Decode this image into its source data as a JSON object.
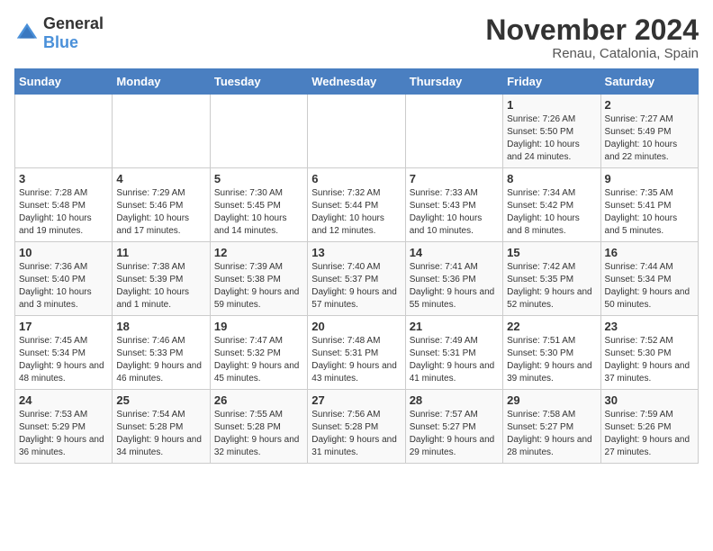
{
  "header": {
    "logo_general": "General",
    "logo_blue": "Blue",
    "month_title": "November 2024",
    "location": "Renau, Catalonia, Spain"
  },
  "days_of_week": [
    "Sunday",
    "Monday",
    "Tuesday",
    "Wednesday",
    "Thursday",
    "Friday",
    "Saturday"
  ],
  "weeks": [
    {
      "days": [
        {
          "num": "",
          "info": ""
        },
        {
          "num": "",
          "info": ""
        },
        {
          "num": "",
          "info": ""
        },
        {
          "num": "",
          "info": ""
        },
        {
          "num": "",
          "info": ""
        },
        {
          "num": "1",
          "info": "Sunrise: 7:26 AM\nSunset: 5:50 PM\nDaylight: 10 hours and 24 minutes."
        },
        {
          "num": "2",
          "info": "Sunrise: 7:27 AM\nSunset: 5:49 PM\nDaylight: 10 hours and 22 minutes."
        }
      ]
    },
    {
      "days": [
        {
          "num": "3",
          "info": "Sunrise: 7:28 AM\nSunset: 5:48 PM\nDaylight: 10 hours and 19 minutes."
        },
        {
          "num": "4",
          "info": "Sunrise: 7:29 AM\nSunset: 5:46 PM\nDaylight: 10 hours and 17 minutes."
        },
        {
          "num": "5",
          "info": "Sunrise: 7:30 AM\nSunset: 5:45 PM\nDaylight: 10 hours and 14 minutes."
        },
        {
          "num": "6",
          "info": "Sunrise: 7:32 AM\nSunset: 5:44 PM\nDaylight: 10 hours and 12 minutes."
        },
        {
          "num": "7",
          "info": "Sunrise: 7:33 AM\nSunset: 5:43 PM\nDaylight: 10 hours and 10 minutes."
        },
        {
          "num": "8",
          "info": "Sunrise: 7:34 AM\nSunset: 5:42 PM\nDaylight: 10 hours and 8 minutes."
        },
        {
          "num": "9",
          "info": "Sunrise: 7:35 AM\nSunset: 5:41 PM\nDaylight: 10 hours and 5 minutes."
        }
      ]
    },
    {
      "days": [
        {
          "num": "10",
          "info": "Sunrise: 7:36 AM\nSunset: 5:40 PM\nDaylight: 10 hours and 3 minutes."
        },
        {
          "num": "11",
          "info": "Sunrise: 7:38 AM\nSunset: 5:39 PM\nDaylight: 10 hours and 1 minute."
        },
        {
          "num": "12",
          "info": "Sunrise: 7:39 AM\nSunset: 5:38 PM\nDaylight: 9 hours and 59 minutes."
        },
        {
          "num": "13",
          "info": "Sunrise: 7:40 AM\nSunset: 5:37 PM\nDaylight: 9 hours and 57 minutes."
        },
        {
          "num": "14",
          "info": "Sunrise: 7:41 AM\nSunset: 5:36 PM\nDaylight: 9 hours and 55 minutes."
        },
        {
          "num": "15",
          "info": "Sunrise: 7:42 AM\nSunset: 5:35 PM\nDaylight: 9 hours and 52 minutes."
        },
        {
          "num": "16",
          "info": "Sunrise: 7:44 AM\nSunset: 5:34 PM\nDaylight: 9 hours and 50 minutes."
        }
      ]
    },
    {
      "days": [
        {
          "num": "17",
          "info": "Sunrise: 7:45 AM\nSunset: 5:34 PM\nDaylight: 9 hours and 48 minutes."
        },
        {
          "num": "18",
          "info": "Sunrise: 7:46 AM\nSunset: 5:33 PM\nDaylight: 9 hours and 46 minutes."
        },
        {
          "num": "19",
          "info": "Sunrise: 7:47 AM\nSunset: 5:32 PM\nDaylight: 9 hours and 45 minutes."
        },
        {
          "num": "20",
          "info": "Sunrise: 7:48 AM\nSunset: 5:31 PM\nDaylight: 9 hours and 43 minutes."
        },
        {
          "num": "21",
          "info": "Sunrise: 7:49 AM\nSunset: 5:31 PM\nDaylight: 9 hours and 41 minutes."
        },
        {
          "num": "22",
          "info": "Sunrise: 7:51 AM\nSunset: 5:30 PM\nDaylight: 9 hours and 39 minutes."
        },
        {
          "num": "23",
          "info": "Sunrise: 7:52 AM\nSunset: 5:30 PM\nDaylight: 9 hours and 37 minutes."
        }
      ]
    },
    {
      "days": [
        {
          "num": "24",
          "info": "Sunrise: 7:53 AM\nSunset: 5:29 PM\nDaylight: 9 hours and 36 minutes."
        },
        {
          "num": "25",
          "info": "Sunrise: 7:54 AM\nSunset: 5:28 PM\nDaylight: 9 hours and 34 minutes."
        },
        {
          "num": "26",
          "info": "Sunrise: 7:55 AM\nSunset: 5:28 PM\nDaylight: 9 hours and 32 minutes."
        },
        {
          "num": "27",
          "info": "Sunrise: 7:56 AM\nSunset: 5:28 PM\nDaylight: 9 hours and 31 minutes."
        },
        {
          "num": "28",
          "info": "Sunrise: 7:57 AM\nSunset: 5:27 PM\nDaylight: 9 hours and 29 minutes."
        },
        {
          "num": "29",
          "info": "Sunrise: 7:58 AM\nSunset: 5:27 PM\nDaylight: 9 hours and 28 minutes."
        },
        {
          "num": "30",
          "info": "Sunrise: 7:59 AM\nSunset: 5:26 PM\nDaylight: 9 hours and 27 minutes."
        }
      ]
    }
  ]
}
